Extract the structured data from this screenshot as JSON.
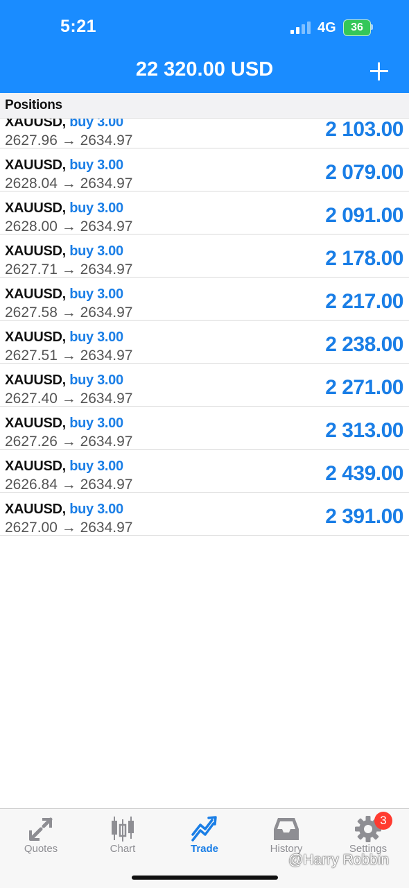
{
  "status_bar": {
    "time": "5:21",
    "network": "4G",
    "battery": "36"
  },
  "header": {
    "balance": "22 320.00 USD"
  },
  "section": {
    "title": "Positions"
  },
  "positions": [
    {
      "symbol": "XAUUSD,",
      "side": "buy 3.00",
      "prices": "2627.96 → 2634.97",
      "profit": "2 103.00"
    },
    {
      "symbol": "XAUUSD,",
      "side": "buy 3.00",
      "prices": "2628.04 → 2634.97",
      "profit": "2 079.00"
    },
    {
      "symbol": "XAUUSD,",
      "side": "buy 3.00",
      "prices": "2628.00 → 2634.97",
      "profit": "2 091.00"
    },
    {
      "symbol": "XAUUSD,",
      "side": "buy 3.00",
      "prices": "2627.71 → 2634.97",
      "profit": "2 178.00"
    },
    {
      "symbol": "XAUUSD,",
      "side": "buy 3.00",
      "prices": "2627.58 → 2634.97",
      "profit": "2 217.00"
    },
    {
      "symbol": "XAUUSD,",
      "side": "buy 3.00",
      "prices": "2627.51 → 2634.97",
      "profit": "2 238.00"
    },
    {
      "symbol": "XAUUSD,",
      "side": "buy 3.00",
      "prices": "2627.40 → 2634.97",
      "profit": "2 271.00"
    },
    {
      "symbol": "XAUUSD,",
      "side": "buy 3.00",
      "prices": "2627.26 → 2634.97",
      "profit": "2 313.00"
    },
    {
      "symbol": "XAUUSD,",
      "side": "buy 3.00",
      "prices": "2626.84 → 2634.97",
      "profit": "2 439.00"
    },
    {
      "symbol": "XAUUSD,",
      "side": "buy 3.00",
      "prices": "2627.00 → 2634.97",
      "profit": "2 391.00"
    }
  ],
  "tabbar": {
    "tabs": [
      {
        "label": "Quotes",
        "icon": "quotes-arrows-icon",
        "active": false
      },
      {
        "label": "Chart",
        "icon": "candlestick-icon",
        "active": false
      },
      {
        "label": "Trade",
        "icon": "trend-arrow-icon",
        "active": true
      },
      {
        "label": "History",
        "icon": "inbox-tray-icon",
        "active": false
      },
      {
        "label": "Settings",
        "icon": "gear-icon",
        "active": false
      }
    ],
    "settings_badge": "3"
  },
  "watermark": "@Harry Robbin",
  "colors": {
    "header_bg": "#1a8cff",
    "accent": "#1a7ee6",
    "badge": "#ff3b30",
    "battery": "#34c759"
  }
}
